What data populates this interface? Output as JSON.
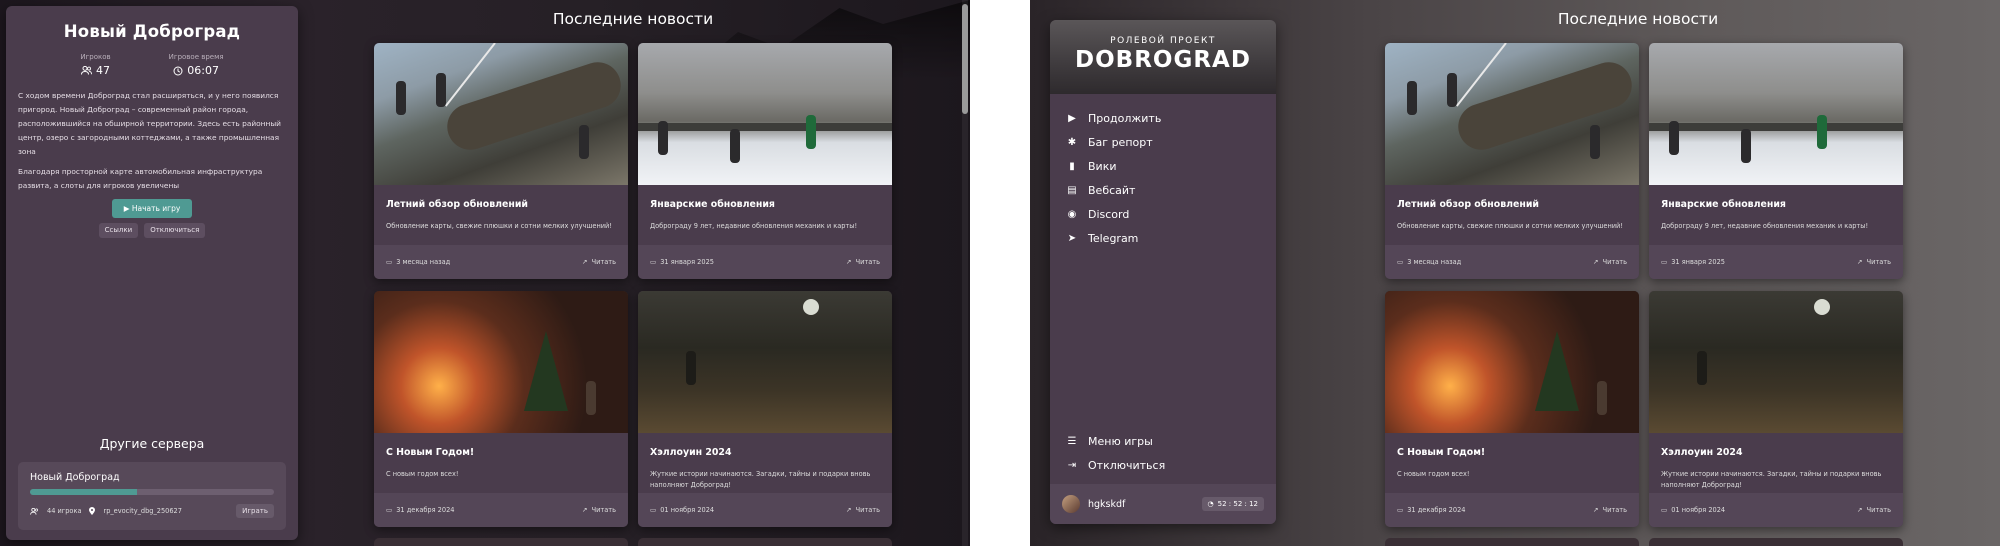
{
  "left": {
    "server_title": "Новый Доброград",
    "stats": [
      {
        "label": "Игроков",
        "value": "47",
        "icon": "people-icon"
      },
      {
        "label": "Игровое время",
        "value": "06:07",
        "icon": "clock-icon"
      }
    ],
    "description": [
      "С ходом времени Доброград стал расширяться, и у него появился пригород. Новый Доброград – современный район города, расположившийся на обширной территории. Здесь есть районный центр, озеро с загородными коттеджами, а также промышленная зона",
      "Благодаря просторной карте автомобильная инфраструктура развита, а слоты для игроков увеличены"
    ],
    "play_button": "Начать игру",
    "links_button": "Ссылки",
    "disconnect_button": "Отключиться",
    "other_servers_title": "Другие сервера",
    "other_server": {
      "name": "Новый Доброград",
      "fill_fraction": 0.44,
      "players": "44 игрока",
      "map": "rp_evocity_dbg_250627",
      "play_label": "Играть"
    }
  },
  "news": {
    "title": "Последние новости",
    "read_label": "Читать",
    "items": [
      {
        "title": "Летний обзор обновлений",
        "text": "Обновление карты, свежие плюшки и сотни мелких улучшений!",
        "date": "3 месяца назад"
      },
      {
        "title": "Январские обновления",
        "text": "Доброграду 9 лет, недавние обновления механик и карты!",
        "date": "31 января 2025"
      },
      {
        "title": "С Новым Годом!",
        "text": "С новым годом всех!",
        "date": "31 декабря 2024"
      },
      {
        "title": "Хэллоуин 2024",
        "text": "Жуткие истории начинаются. Загадки, тайны и подарки вновь наполняют Доброград!",
        "date": "01 ноября 2024"
      }
    ]
  },
  "right": {
    "logo_sub": "РОЛЕВОЙ ПРОЕКТ",
    "logo_main": "DOBROGRAD",
    "menu": [
      {
        "label": "Продолжить",
        "icon": "play-icon"
      },
      {
        "label": "Баг репорт",
        "icon": "bug-icon"
      },
      {
        "label": "Вики",
        "icon": "book-icon"
      },
      {
        "label": "Вебсайт",
        "icon": "newspaper-icon"
      },
      {
        "label": "Discord",
        "icon": "discord-icon"
      },
      {
        "label": "Telegram",
        "icon": "telegram-icon"
      }
    ],
    "menu_bottom": [
      {
        "label": "Меню игры",
        "icon": "list-icon"
      },
      {
        "label": "Отключиться",
        "icon": "logout-icon"
      }
    ],
    "username": "hgkskdf",
    "session_time": "52 : 52 : 12"
  }
}
